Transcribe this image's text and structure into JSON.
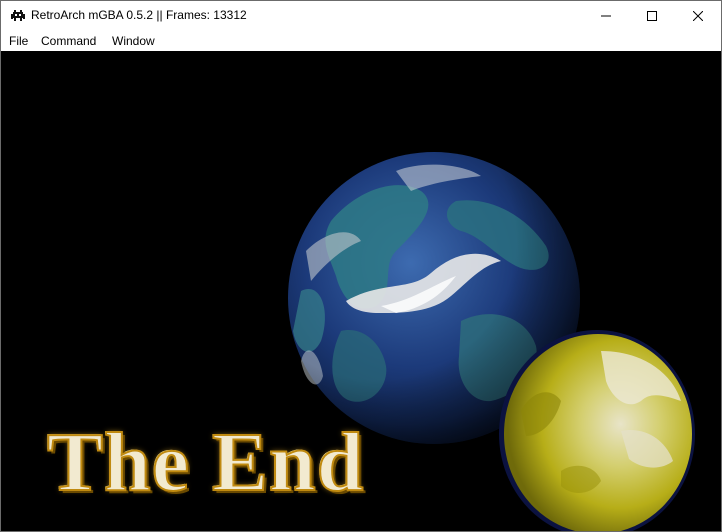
{
  "window": {
    "title": "RetroArch mGBA 0.5.2 || Frames: 13312",
    "icon": "retroarch-invader-icon",
    "controls": [
      "minimize-icon",
      "maximize-icon",
      "close-icon"
    ]
  },
  "menu": {
    "file": "File",
    "command": "Command",
    "window": "Window"
  },
  "game": {
    "caption": "The End",
    "scene": [
      "earth-globe",
      "yellow-moon"
    ],
    "colors": {
      "background": "#000000",
      "earth": "#1c3a7a",
      "moon": "#c8c028",
      "caption": "#f2ead0"
    }
  }
}
